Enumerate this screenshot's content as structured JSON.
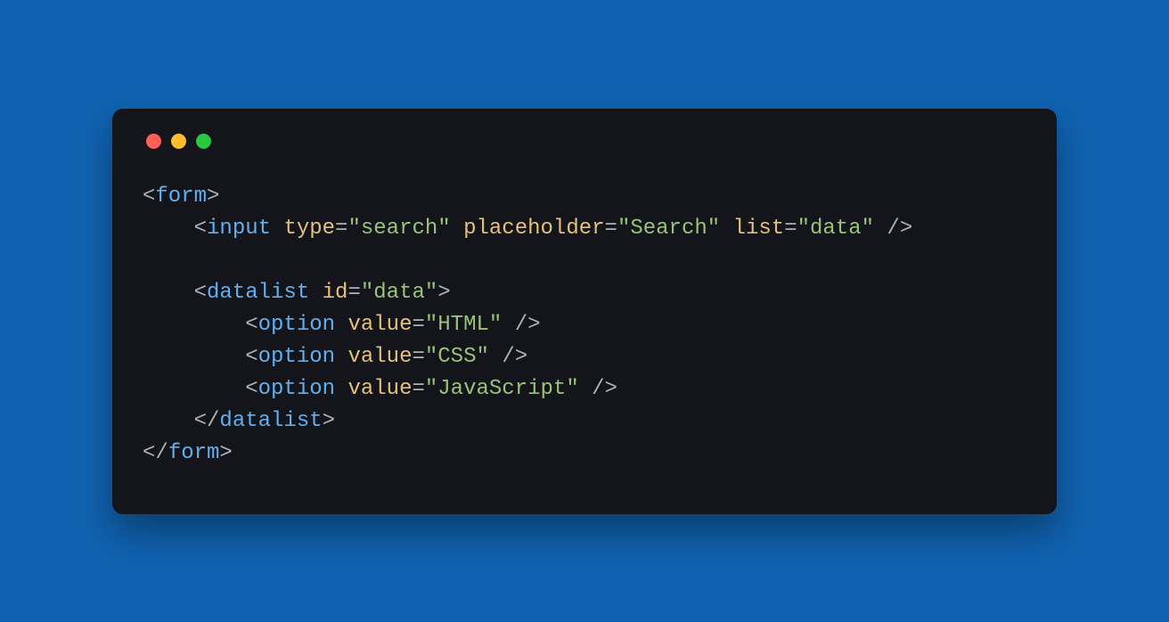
{
  "window": {
    "traffic_lights": {
      "red": "#ff5f56",
      "yellow": "#ffbd2e",
      "green": "#27c93f"
    }
  },
  "code": {
    "tags": {
      "form": "form",
      "input": "input",
      "datalist": "datalist",
      "option": "option"
    },
    "attrs": {
      "type": "type",
      "placeholder": "placeholder",
      "list": "list",
      "id": "id",
      "value": "value"
    },
    "values": {
      "search": "search",
      "Search": "Search",
      "data": "data",
      "HTML": "HTML",
      "CSS": "CSS",
      "JavaScript": "JavaScript"
    }
  }
}
